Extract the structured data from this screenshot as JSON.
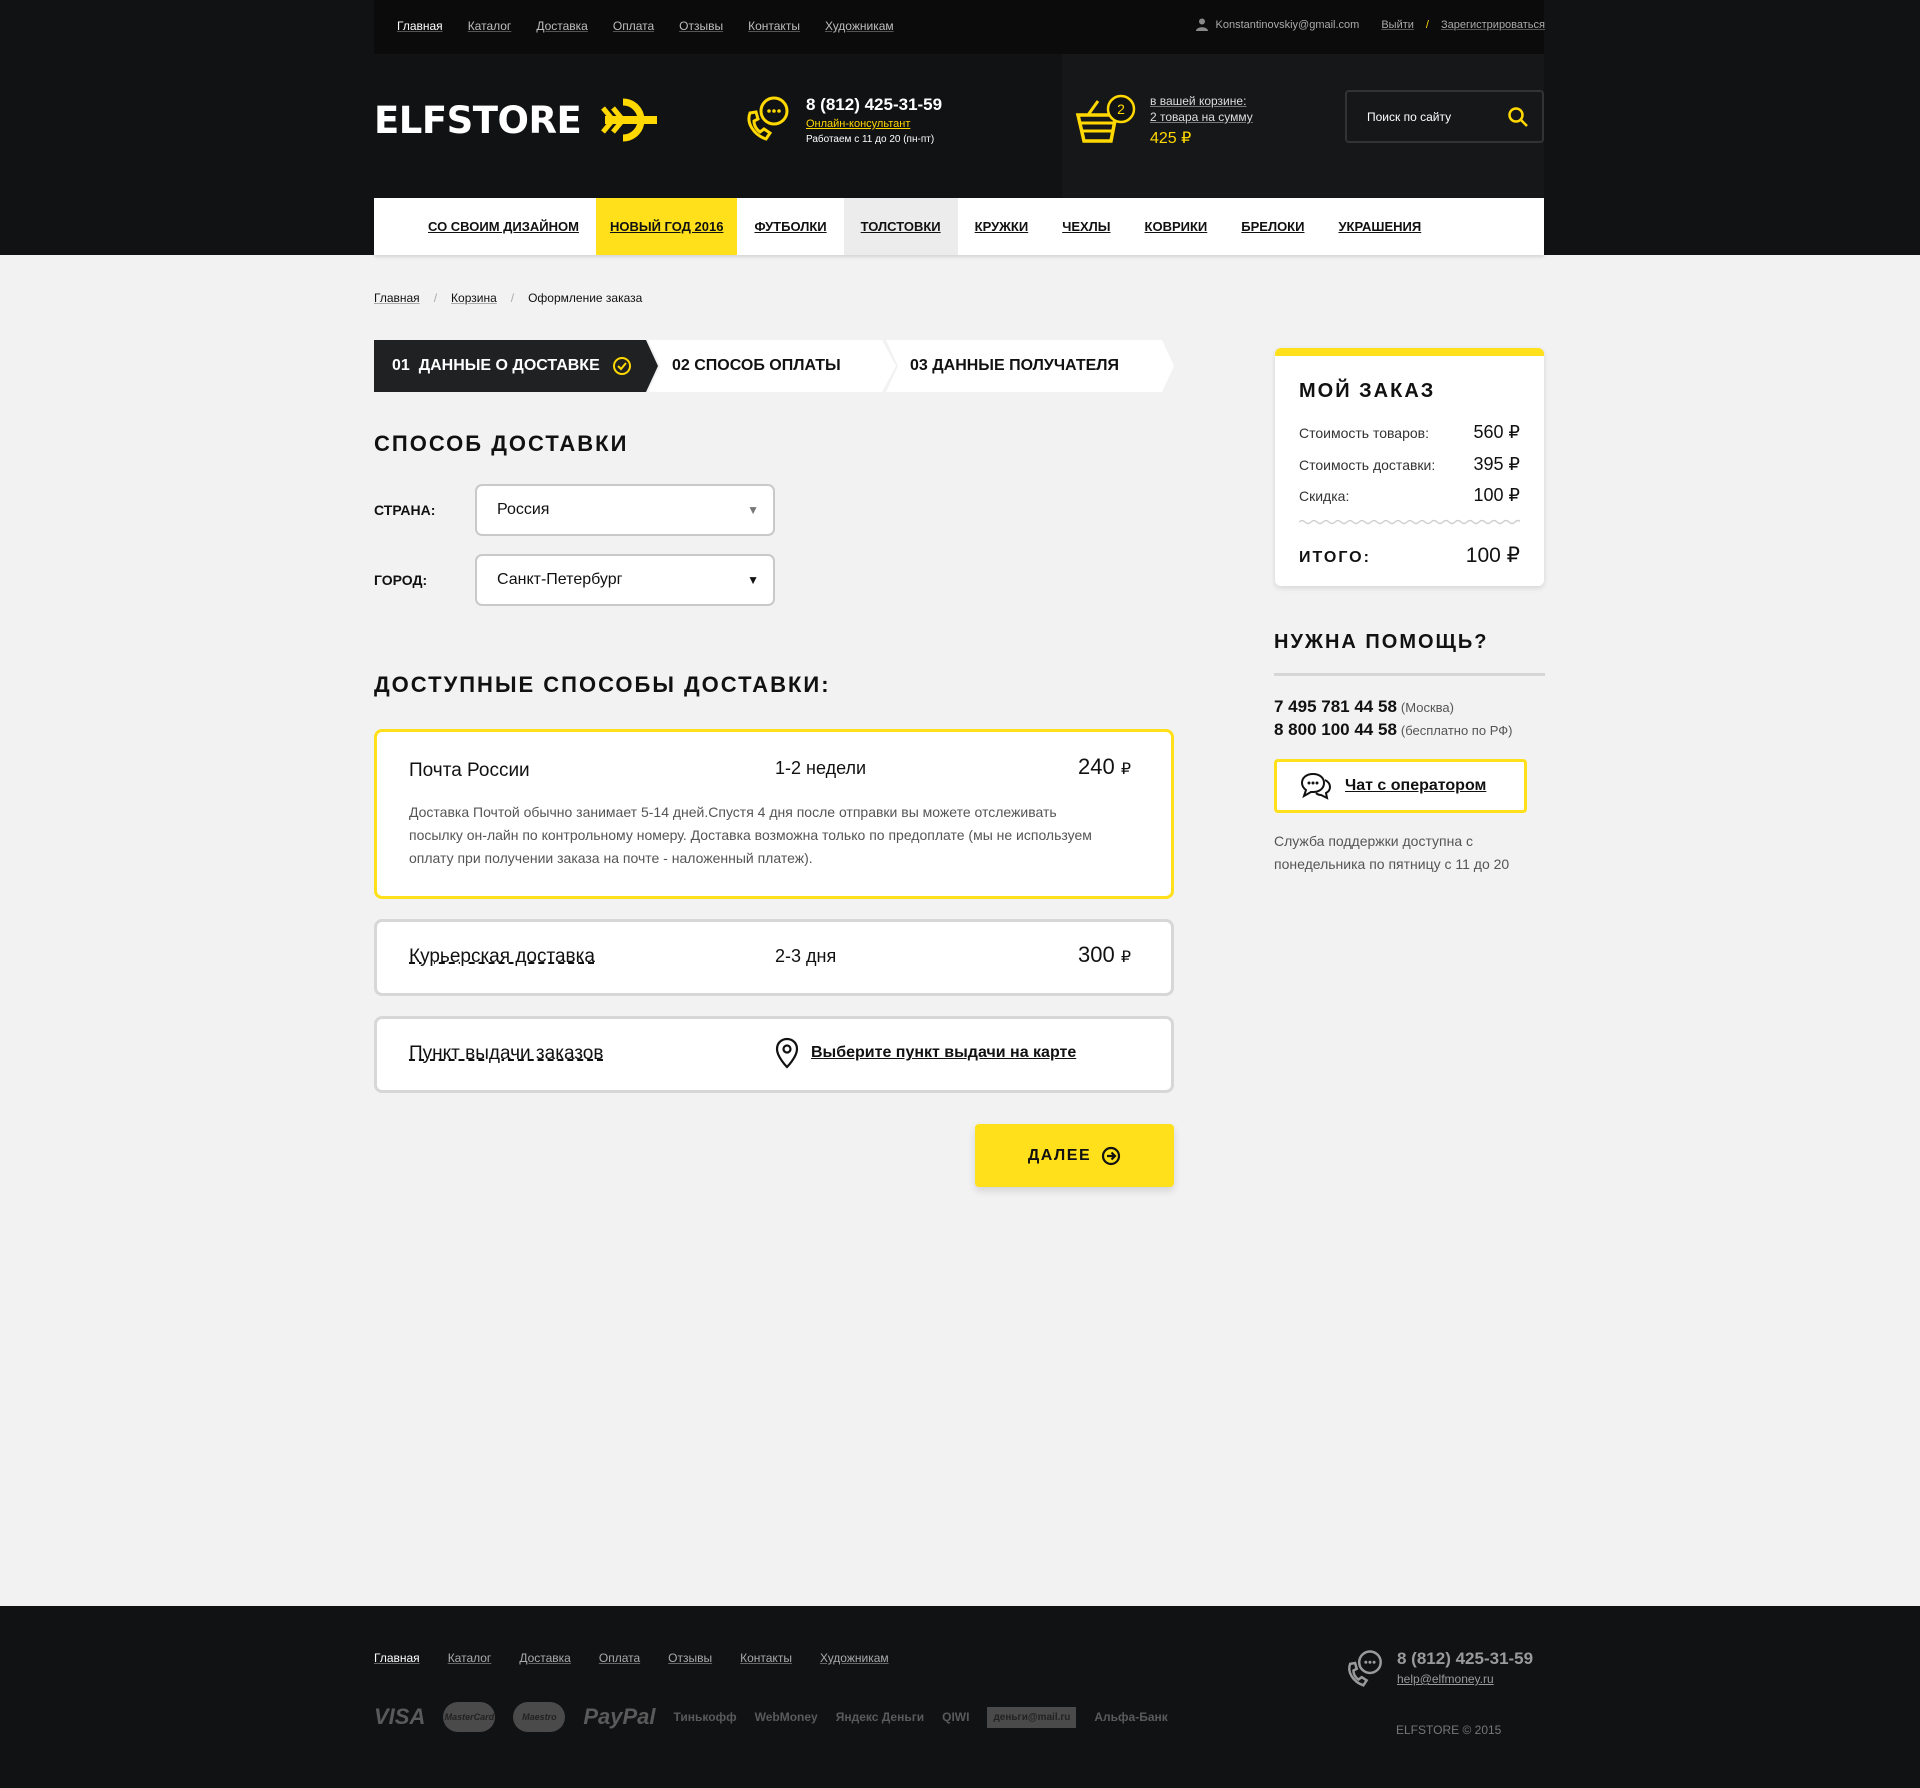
{
  "header": {
    "topnav": [
      "Главная",
      "Каталог",
      "Доставка",
      "Оплата",
      "Отзывы",
      "Контакты",
      "Художникам"
    ],
    "user_email": "Konstantinovskiy@gmail.com",
    "logout": "Выйти",
    "slash": "/",
    "register": "Зарегистрироваться",
    "logo": "ELFSTORE",
    "phone": "8 (812) 425-31-59",
    "consultant": "Онлайн-консультант",
    "hours": "Работаем с 11 до 20 (пн-пт)",
    "cart_count": "2",
    "cart_line1": "в вашей корзине:",
    "cart_line2": "2 товара на сумму",
    "cart_sum": "425 ₽",
    "search_placeholder": "Поиск по сайту"
  },
  "categories": [
    "СО СВОИМ ДИЗАЙНОМ",
    "НОВЫЙ ГОД 2016",
    "ФУТБОЛКИ",
    "ТОЛСТОВКИ",
    "КРУЖКИ",
    "ЧЕХЛЫ",
    "КОВРИКИ",
    "БРЕЛОКИ",
    "УКРАШЕНИЯ"
  ],
  "breadcrumb": [
    "Главная",
    "Корзина",
    "Оформление заказа"
  ],
  "breadcrumb_sep": "/",
  "steps": [
    "01  ДАННЫЕ О ДОСТАВКЕ",
    "02 СПОСОБ ОПЛАТЫ",
    "03 ДАННЫЕ ПОЛУЧАТЕЛЯ"
  ],
  "delivery": {
    "title": "СПОСОБ ДОСТАВКИ",
    "country_label": "СТРАНА:",
    "country_value": "Россия",
    "city_label": "ГОРОД:",
    "city_value": "Санкт-Петербург",
    "arrow": "▼",
    "available_title": "ДОСТУПНЫЕ СПОСОБЫ ДОСТАВКИ:",
    "options": [
      {
        "name": "Почта России",
        "term": "1-2 недели",
        "price": "240",
        "currency": "₽",
        "desc": "Доставка Почтой обычно занимает 5-14 дней.Спустя 4 дня после отправки вы можете отслеживать посылку он-лайн по контрольному номеру. Доставка возможна только по предоплате (мы не используем оплату при получении заказа на почте - наложенный платеж)."
      },
      {
        "name": "Курьерская доставка",
        "term": "2-3 дня",
        "price": "300",
        "currency": "₽"
      },
      {
        "name": "Пункт выдачи заказов",
        "map_link": "Выберите пункт выдачи на карте"
      }
    ],
    "next_button": "ДАЛЕЕ"
  },
  "order": {
    "title": "МОЙ ЗАКАЗ",
    "rows": [
      {
        "label": "Стоимость товаров:",
        "value": "560 ₽"
      },
      {
        "label": "Стоимость доставки:",
        "value": "395 ₽"
      },
      {
        "label": "Скидка:",
        "value": "100 ₽"
      }
    ],
    "total_label": "ИТОГО:",
    "total_value": "100 ₽"
  },
  "help": {
    "title": "НУЖНА ПОМОЩЬ?",
    "phone1": "7 495 781 44 58",
    "phone1_note": "(Москва)",
    "phone2": "8 800 100 44 58",
    "phone2_note": "(бесплатно по РФ)",
    "chat_button": "Чат с оператором",
    "note": "Служба поддержки доступна с понедельника по пятницу с 11 до 20"
  },
  "footer": {
    "nav": [
      "Главная",
      "Каталог",
      "Доставка",
      "Оплата",
      "Отзывы",
      "Контакты",
      "Художникам"
    ],
    "pay": [
      "VISA",
      "MasterCard",
      "Maestro",
      "PayPal",
      "Тинькофф",
      "WebMoney",
      "Яндекс Деньги",
      "QIWI",
      "деньги@mail.ru",
      "Альфа-Банк"
    ],
    "phone": "8 (812) 425-31-59",
    "email": "help@elfmoney.ru",
    "copyright": "ELFSTORE © 2015"
  },
  "colors": {
    "accent": "#ffe01a",
    "dark": "#111214",
    "page_bg": "#f2f2f2"
  }
}
